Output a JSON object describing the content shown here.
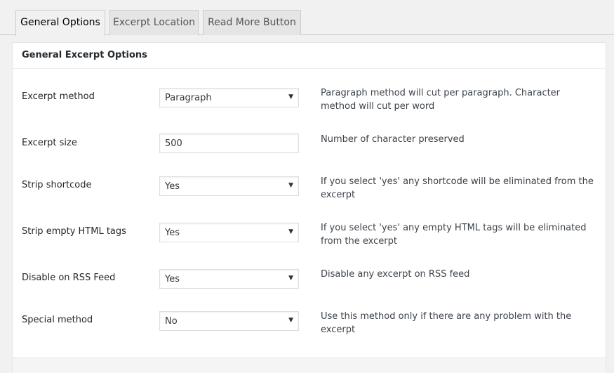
{
  "tabs": [
    {
      "label": "General Options"
    },
    {
      "label": "Excerpt Location"
    },
    {
      "label": "Read More Button"
    }
  ],
  "panel": {
    "title": "General Excerpt Options"
  },
  "rows": [
    {
      "label": "Excerpt method",
      "value": "Paragraph",
      "type": "select",
      "description": "Paragraph method will cut per paragraph. Character method will cut per word"
    },
    {
      "label": "Excerpt size",
      "value": "500",
      "type": "text",
      "description": "Number of character preserved"
    },
    {
      "label": "Strip shortcode",
      "value": "Yes",
      "type": "select",
      "description": "If you select 'yes' any shortcode will be eliminated from the excerpt"
    },
    {
      "label": "Strip empty HTML tags",
      "value": "Yes",
      "type": "select",
      "description": "If you select 'yes' any empty HTML tags will be eliminated from the excerpt"
    },
    {
      "label": "Disable on RSS Feed",
      "value": "Yes",
      "type": "select",
      "description": "Disable any excerpt on RSS feed"
    },
    {
      "label": "Special method",
      "value": "No",
      "type": "select",
      "description": "Use this method only if there are any problem with the excerpt"
    }
  ],
  "icons": {
    "dropdown": "chevron-down-icon",
    "dropdown_glyph": "▼"
  },
  "colors": {
    "background": "#f1f1f1",
    "panel": "#ffffff",
    "border": "#cccccc",
    "inactive_tab": "#e5e5e5"
  }
}
